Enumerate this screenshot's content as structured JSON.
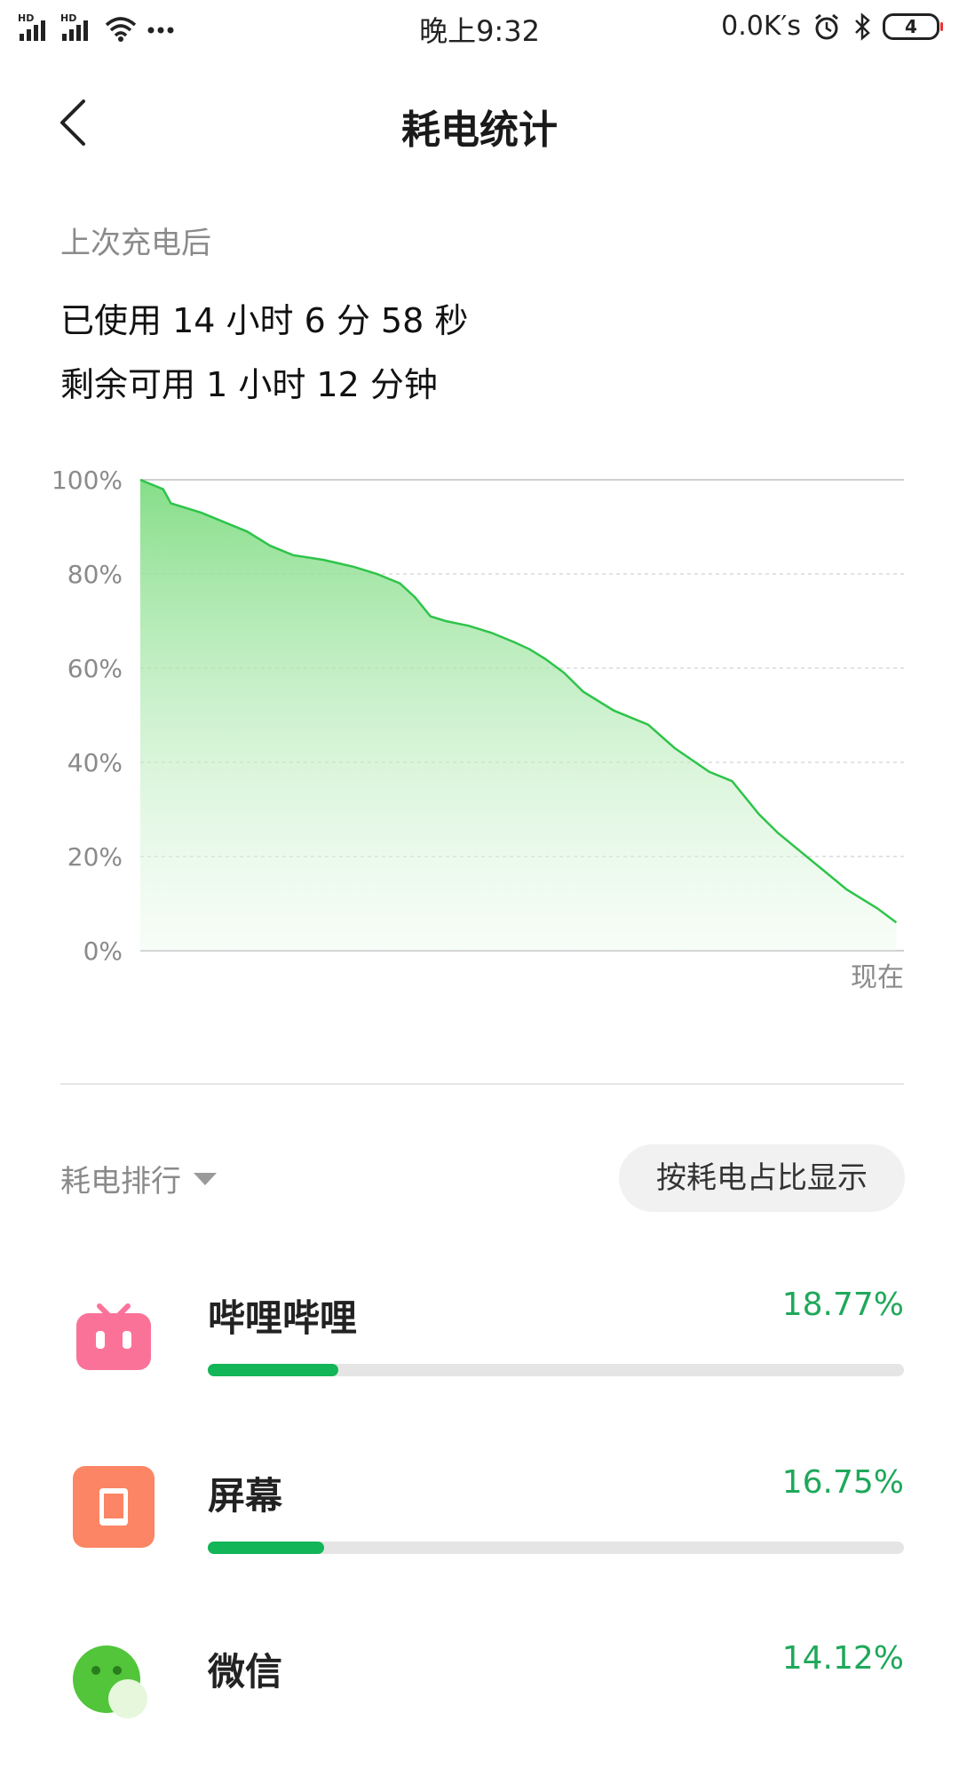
{
  "status_bar": {
    "signal1": "HD",
    "signal2": "HD",
    "time": "晚上9:32",
    "speed": "0.0K′s",
    "battery": "4",
    "icons": [
      "signal-icon",
      "signal-icon",
      "wifi-icon",
      "more-icon",
      "alarm-icon",
      "bluetooth-icon",
      "battery-icon"
    ]
  },
  "header": {
    "title": "耗电统计"
  },
  "summary": {
    "since": "上次充电后",
    "used": "已使用 14 小时 6 分 58 秒",
    "remaining": "剩余可用 1 小时 12 分钟"
  },
  "chart_data": {
    "type": "area",
    "ylim": [
      0,
      100
    ],
    "ytick_labels": [
      "100%",
      "80%",
      "60%",
      "40%",
      "20%",
      "0%"
    ],
    "x_end_label": "现在",
    "color": "#2ec44a",
    "x": [
      0,
      0.03,
      0.04,
      0.08,
      0.11,
      0.14,
      0.17,
      0.2,
      0.24,
      0.28,
      0.31,
      0.34,
      0.36,
      0.38,
      0.4,
      0.43,
      0.46,
      0.49,
      0.51,
      0.53,
      0.555,
      0.58,
      0.62,
      0.665,
      0.7,
      0.745,
      0.775,
      0.79,
      0.81,
      0.835,
      0.865,
      0.895,
      0.925,
      0.965,
      0.99
    ],
    "y": [
      100,
      98,
      95,
      93,
      91,
      89,
      86,
      84,
      83,
      81.5,
      80,
      78,
      75,
      71,
      70,
      69,
      67.5,
      65.5,
      64,
      62,
      59,
      55,
      51,
      48,
      43,
      38,
      36,
      33,
      29,
      25,
      21,
      17,
      13,
      9,
      6
    ]
  },
  "ranking": {
    "label": "耗电排行",
    "mode_button": "按耗电占比显示",
    "items": [
      {
        "name": "哔哩哔哩",
        "percent": "18.77%",
        "value": 18.77,
        "icon": "bilibili-icon",
        "color": "#fb7299"
      },
      {
        "name": "屏幕",
        "percent": "16.75%",
        "value": 16.75,
        "icon": "screen-icon",
        "color": "#fb8564"
      },
      {
        "name": "微信",
        "percent": "14.12%",
        "value": 14.12,
        "icon": "wechat-icon",
        "color": "#52c53a"
      }
    ]
  }
}
